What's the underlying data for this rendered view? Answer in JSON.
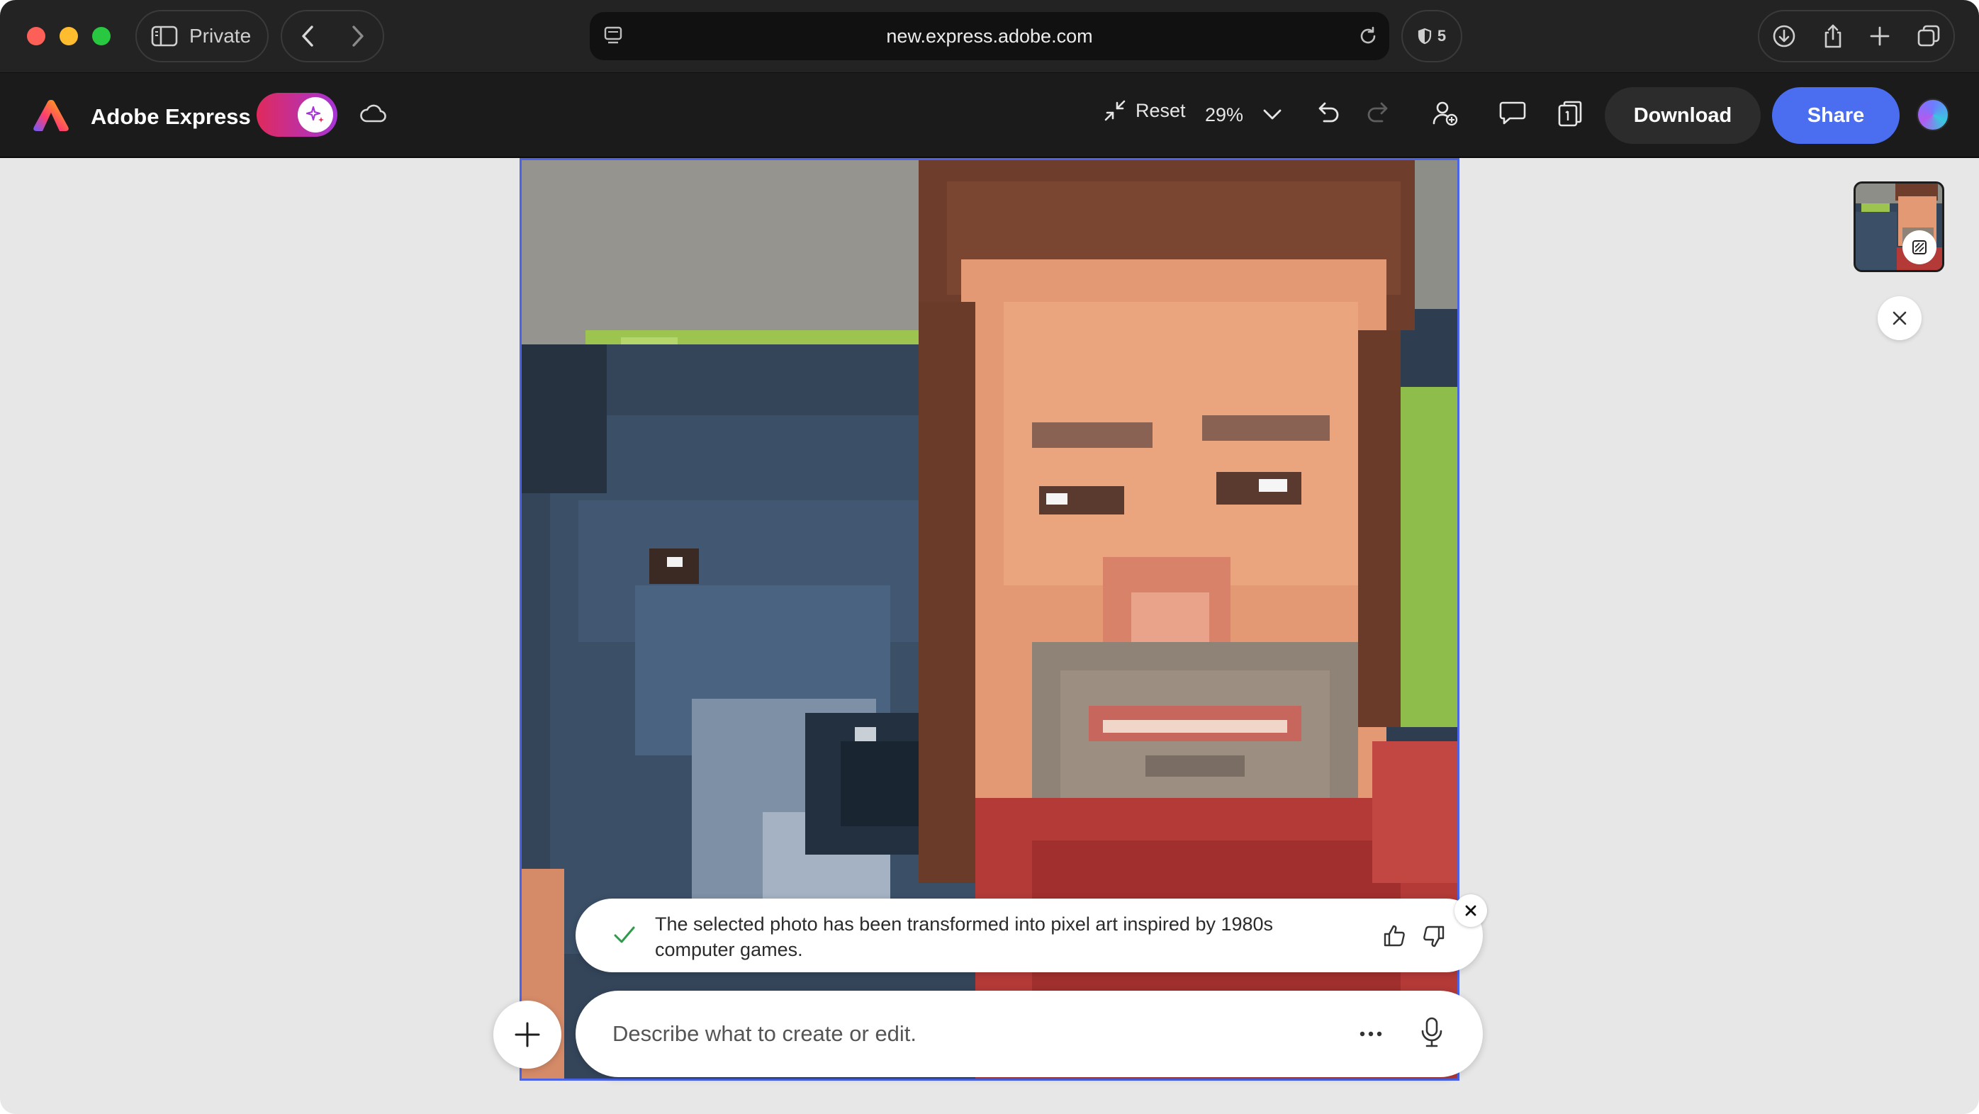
{
  "browser": {
    "private_label": "Private",
    "url": "new.express.adobe.com",
    "shield_count": "5"
  },
  "app": {
    "name": "Adobe Express",
    "reset_label": "Reset",
    "zoom": "29%",
    "download_label": "Download",
    "share_label": "Share"
  },
  "toast": {
    "message": "The selected photo has been transformed into pixel art inspired by 1980s computer games."
  },
  "prompt": {
    "placeholder": "Describe what to create or edit."
  },
  "icons": {
    "sidebar": "sidebar-icon",
    "back": "chevron-left-icon",
    "forward": "chevron-right-icon",
    "reload": "reload-icon",
    "shield": "shield-icon",
    "download": "download-icon",
    "share": "share-icon",
    "new_tab": "plus-icon",
    "tabs": "tabs-icon",
    "cloud": "cloud-icon",
    "undo": "undo-icon",
    "redo": "redo-icon",
    "invite": "add-person-icon",
    "comment": "comment-icon",
    "pages": "pages-icon",
    "mic": "microphone-icon"
  },
  "colors": {
    "accent": "#4b6ef0",
    "selection": "#4a63e8",
    "toggle_start": "#e02a5c",
    "toggle_end": "#a634d6",
    "success": "#2e9a4a"
  }
}
